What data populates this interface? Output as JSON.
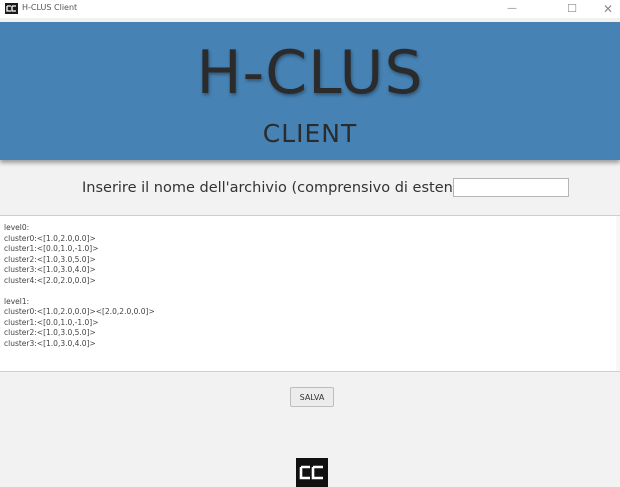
{
  "window": {
    "title": "H-CLUS Client",
    "minimize_glyph": "—",
    "maximize_glyph": "☐",
    "close_glyph": "✕",
    "icon": "app-logo-icon"
  },
  "banner": {
    "title": "H-CLUS",
    "subtitle": "CLIENT",
    "background_color": "#4682b4"
  },
  "form": {
    "prompt_label": "Inserire il nome dell'archivio (comprensivo di estensione)",
    "filename_value": "",
    "filename_placeholder": ""
  },
  "output": {
    "lines": [
      "level0:",
      "cluster0:<[1.0,2.0,0.0]>",
      "cluster1:<[0.0,1.0,-1.0]>",
      "cluster2:<[1.0,3.0,5.0]>",
      "cluster3:<[1.0,3.0,4.0]>",
      "cluster4:<[2.0,2.0,0.0]>",
      "",
      "level1:",
      "cluster0:<[1.0,2.0,0.0]><[2.0,2.0,0.0]>",
      "cluster1:<[0.0,1.0,-1.0]>",
      "cluster2:<[1.0,3.0,5.0]>",
      "cluster3:<[1.0,3.0,4.0]>"
    ]
  },
  "actions": {
    "save_label": "SALVA"
  },
  "footer": {
    "logo": "app-logo-icon"
  }
}
